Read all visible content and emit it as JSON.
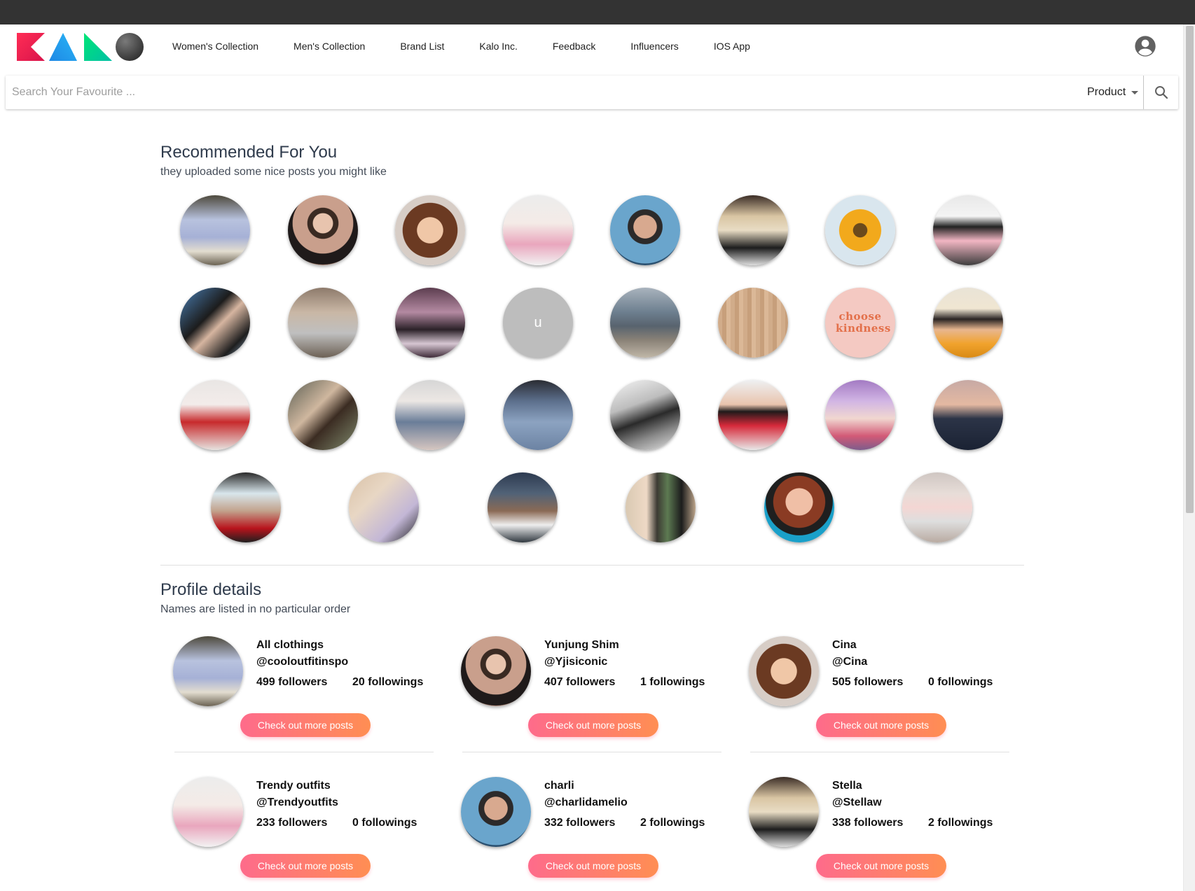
{
  "nav": {
    "logo_name": "KALO",
    "links": [
      "Women's Collection",
      "Men's Collection",
      "Brand List",
      "Kalo Inc.",
      "Feedback",
      "Influencers",
      "IOS App"
    ]
  },
  "search": {
    "placeholder": "Search Your Favourite ...",
    "select_value": "Product"
  },
  "recommended": {
    "title": "Recommended For You",
    "subtitle": "they uploaded some nice posts you might like",
    "placeholder_avatar_letter": "u",
    "choose_kindness_text": "choose kindness"
  },
  "profiles": {
    "title": "Profile details",
    "subtitle": "Names are listed in no particular order",
    "button_label": "Check out more posts",
    "cards": [
      {
        "name": "All clothings",
        "handle": "@cooloutfitinspo",
        "followers": "499 followers",
        "followings": "20 followings"
      },
      {
        "name": "Yunjung Shim",
        "handle": "@Yjisiconic",
        "followers": "407 followers",
        "followings": "1 followings"
      },
      {
        "name": "Cina",
        "handle": "@Cina",
        "followers": "505 followers",
        "followings": "0 followings"
      },
      {
        "name": "Trendy outfits",
        "handle": "@Trendyoutfits",
        "followers": "233 followers",
        "followings": "0 followings"
      },
      {
        "name": "charli",
        "handle": "@charlidamelio",
        "followers": "332 followers",
        "followings": "2 followings"
      },
      {
        "name": "Stella",
        "handle": "@Stellaw",
        "followers": "338 followers",
        "followings": "2 followings"
      }
    ]
  },
  "colors": {
    "topbar": "#333333",
    "button_gradient_start": "#fe6b8b",
    "button_gradient_end": "#ff8e53",
    "title": "#2f3b4c"
  }
}
